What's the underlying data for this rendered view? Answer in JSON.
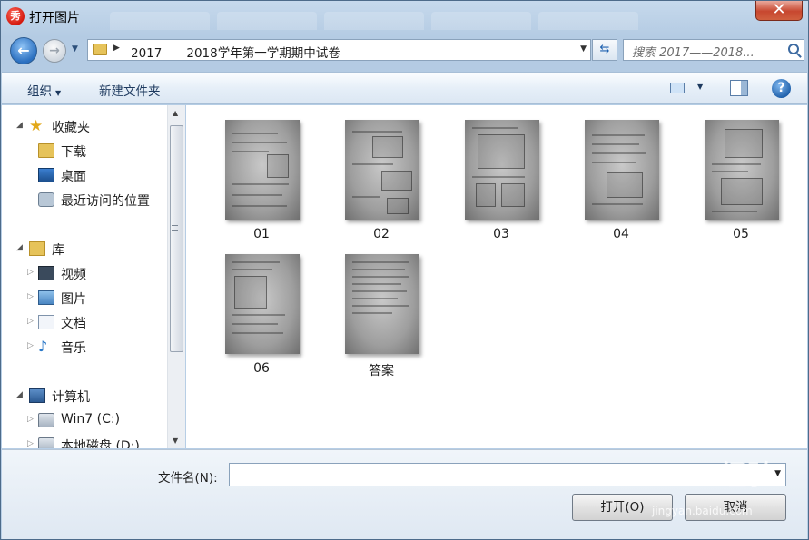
{
  "window": {
    "title": "打开图片",
    "app_icon_text": "秀",
    "close_label": "✕"
  },
  "address": {
    "path": "2017——2018学年第一学期期中试卷"
  },
  "search": {
    "placeholder": "搜索 2017——2018..."
  },
  "toolbar": {
    "organize_label": "组织",
    "new_folder_label": "新建文件夹",
    "help_label": "?"
  },
  "nav": {
    "favorites": "收藏夹",
    "downloads": "下载",
    "desktop": "桌面",
    "recent": "最近访问的位置",
    "libraries": "库",
    "videos": "视频",
    "pictures": "图片",
    "documents": "文档",
    "music": "音乐",
    "computer": "计算机",
    "drive_c": "Win7 (C:)",
    "drive_d": "本地磁盘 (D:)"
  },
  "files": [
    {
      "label": "01"
    },
    {
      "label": "02"
    },
    {
      "label": "03"
    },
    {
      "label": "04"
    },
    {
      "label": "05"
    },
    {
      "label": "06"
    },
    {
      "label": "答案"
    }
  ],
  "footer": {
    "filename_label": "文件名(N):",
    "filename_value": "",
    "open_label": "打开(O)",
    "cancel_label": "取消"
  },
  "watermark": {
    "main": "Baidu经验",
    "sub": "jingyan.baidu.com"
  },
  "colors": {
    "frame": "#b8cfe6",
    "close": "#c7472f",
    "accent": "#1d5ea8"
  }
}
